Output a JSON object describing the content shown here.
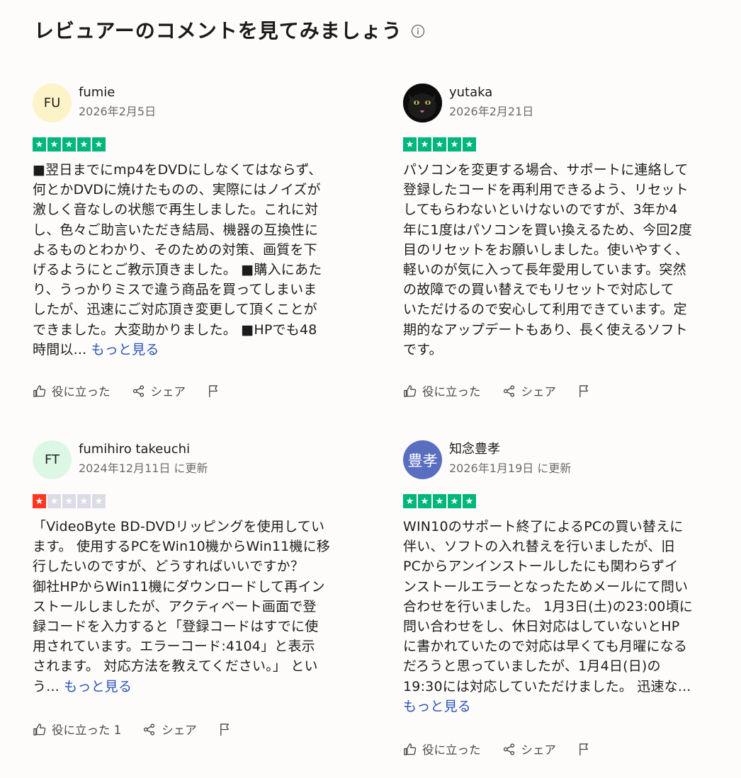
{
  "section": {
    "title": "レビュアーのコメントを見てみましょう"
  },
  "actions": {
    "helpful": "役に立った",
    "share": "シェア"
  },
  "colors": {
    "star_green": "#00b67a",
    "star_red": "#ff3722",
    "star_empty": "#dcdce6",
    "link": "#2a54b8"
  },
  "reviews": [
    {
      "avatar_text": "FU",
      "name": "fumie",
      "date": "2026年2月5日",
      "rating": 5,
      "lines": [
        "■翌日までにmp4をDVDにしなくてはならず、",
        "何とかDVDに焼けたものの、実際にはノイズが",
        "激しく音なしの状態で再生しました。これに対",
        "し、色々ご助言いただき結局、機器の互換性に",
        "よるものとわかり、そのための対策、画質を下",
        "げるようにとご教示頂きました。 ■購入にあた",
        "り、うっかりミスで違う商品を買ってしまいま",
        "したが、迅速にご対応頂き変更して頂くことが",
        "できました。大変助かりました。 ■HPでも48",
        "時間以... "
      ],
      "more": "もっと見る",
      "helpful_label": "役に立った"
    },
    {
      "avatar_text": "",
      "name": "yutaka",
      "date": "2026年2月21日",
      "rating": 5,
      "lines": [
        "パソコンを変更する場合、サポートに連絡して",
        "登録したコードを再利用できるよう、リセット",
        "してもらわないといけないのですが、3年か4",
        "年に1度はパソコンを買い換えるため、今回2度",
        "目のリセットをお願いしました。使いやすく、",
        "軽いのが気に入って長年愛用しています。突然",
        "の故障での買い替えでもリセットで対応して",
        "いただけるので安心して利用できています。定",
        "期的なアップデートもあり、長く使えるソフト",
        "です。"
      ],
      "more": "",
      "helpful_label": "役に立った"
    },
    {
      "avatar_text": "FT",
      "name": "fumihiro takeuchi",
      "date": "2024年12月11日 に更新",
      "rating": 1,
      "lines": [
        "「VideoByte BD-DVDリッピングを使用してい",
        "ます。 使用するPCをWin10機からWin11機に移",
        "行したいのですが、どうすればいいですか？",
        "御社HPからWin11機にダウンロードして再イン",
        "ストールしましたが、アクティベート画面で登",
        "録コードを入力すると「登録コードはすでに使",
        "用されています。エラーコード:4104」と表示",
        "されます。 対応方法を教えてください。」 とい",
        "う... "
      ],
      "more": "もっと見る",
      "helpful_label": "役に立った 1"
    },
    {
      "avatar_text": "豊孝",
      "name": "知念豊孝",
      "date": "2026年1月19日 に更新",
      "rating": 5,
      "lines": [
        "WIN10のサポート終了によるPCの買い替えに",
        "伴い、ソフトの入れ替えを行いましたが、旧",
        "PCからアンインストールしたにも関わらずイ",
        "ンストールエラーとなったためメールにて問い",
        "合わせを行いました。 1月3日(土)の23:00頃に",
        "問い合わせをし、休日対応はしていないとHP",
        "に書かれていたので対応は早くても月曜になる",
        "だろうと思っていましたが、1月4日(日)の",
        "19:30には対応していただけました。 迅速な..."
      ],
      "more": "もっと見る",
      "helpful_label": "役に立った"
    }
  ]
}
